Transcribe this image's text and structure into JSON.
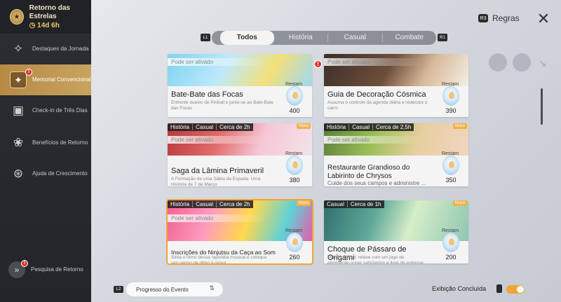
{
  "event": {
    "title": "Retorno das Estrelas",
    "timer": "14d 6h"
  },
  "sidebar": {
    "items": [
      {
        "label": "Destaques da Jornada"
      },
      {
        "label": "Memorial Convencional"
      },
      {
        "label": "Check-in de Três Dias"
      },
      {
        "label": "Benefícios de Retorno"
      },
      {
        "label": "Ajuda de Crescimento"
      }
    ],
    "bottom": {
      "label": "Pesquisa de Retorno"
    }
  },
  "header": {
    "rules_label": "Regras",
    "rules_key": "R3",
    "close_label": "✕"
  },
  "tabs": [
    "Todos",
    "História",
    "Casual",
    "Combate"
  ],
  "shoulders": {
    "left": "L1",
    "right": "R1"
  },
  "cards": [
    {
      "tags": [],
      "new": "",
      "state": "Pode ser ativado",
      "name": "Bate-Bate das Focas",
      "desc": "Enfrente duelos de Pinball e junte-se ao Bate-Bate das Focas",
      "restam": "Restam",
      "reward": "400"
    },
    {
      "tags": [],
      "new": "",
      "state": "Pode ser ativado",
      "name": "Guia de Decoração Cósmica",
      "desc": "Assuma o controle da agenda diária e redecore o carro",
      "restam": "Restam",
      "reward": "390"
    },
    {
      "tags": [
        "História",
        "Casual",
        "Cerca de 2h"
      ],
      "new": "Novo",
      "state": "Pode ser ativado",
      "name": "Saga da Lâmina Primaveril",
      "desc": "A Formação de uma Sábia da Espada: Uma História de 7 de Março",
      "restam": "Restam",
      "reward": "380"
    },
    {
      "tags": [
        "História",
        "Casual",
        "Cerca de 2,5h"
      ],
      "new": "Novo",
      "state": "Pode ser ativado",
      "name": "Restaurante Grandioso do Labirinto de Chrysos",
      "desc": "Cuide dos seus campos e administre ...",
      "restam": "Restam",
      "reward": "350"
    },
    {
      "tags": [
        "História",
        "Casual",
        "Cerca de 2h"
      ],
      "new": "Novo",
      "state": "Pode ser ativado",
      "name": "Inscrições do Ninjutsu da Caça ao Som",
      "desc": "Sinta o ritmo dessa rapsódia musical e coloque seu senso de ritmo à prova",
      "restam": "Restam",
      "reward": "260"
    },
    {
      "tags": [
        "Casual",
        "Cerca de 1h"
      ],
      "new": "Novo",
      "state": "Pode ser ativado",
      "name": "Choque de Pássaro de Origami",
      "desc": "Versão Oficial: relaxe com um jogo de eliminação super satisfatório e livre de estresse",
      "restam": "Restam",
      "reward": "200"
    }
  ],
  "footer": {
    "progress_label": "Progresso do Evento",
    "l2": "L2",
    "exibicao_label": "Exibição Concluída",
    "exibicao_on": true
  },
  "colors": {
    "accent": "#f0a533",
    "sidebar_active": "#c9a35f",
    "alert": "#d8362f"
  }
}
